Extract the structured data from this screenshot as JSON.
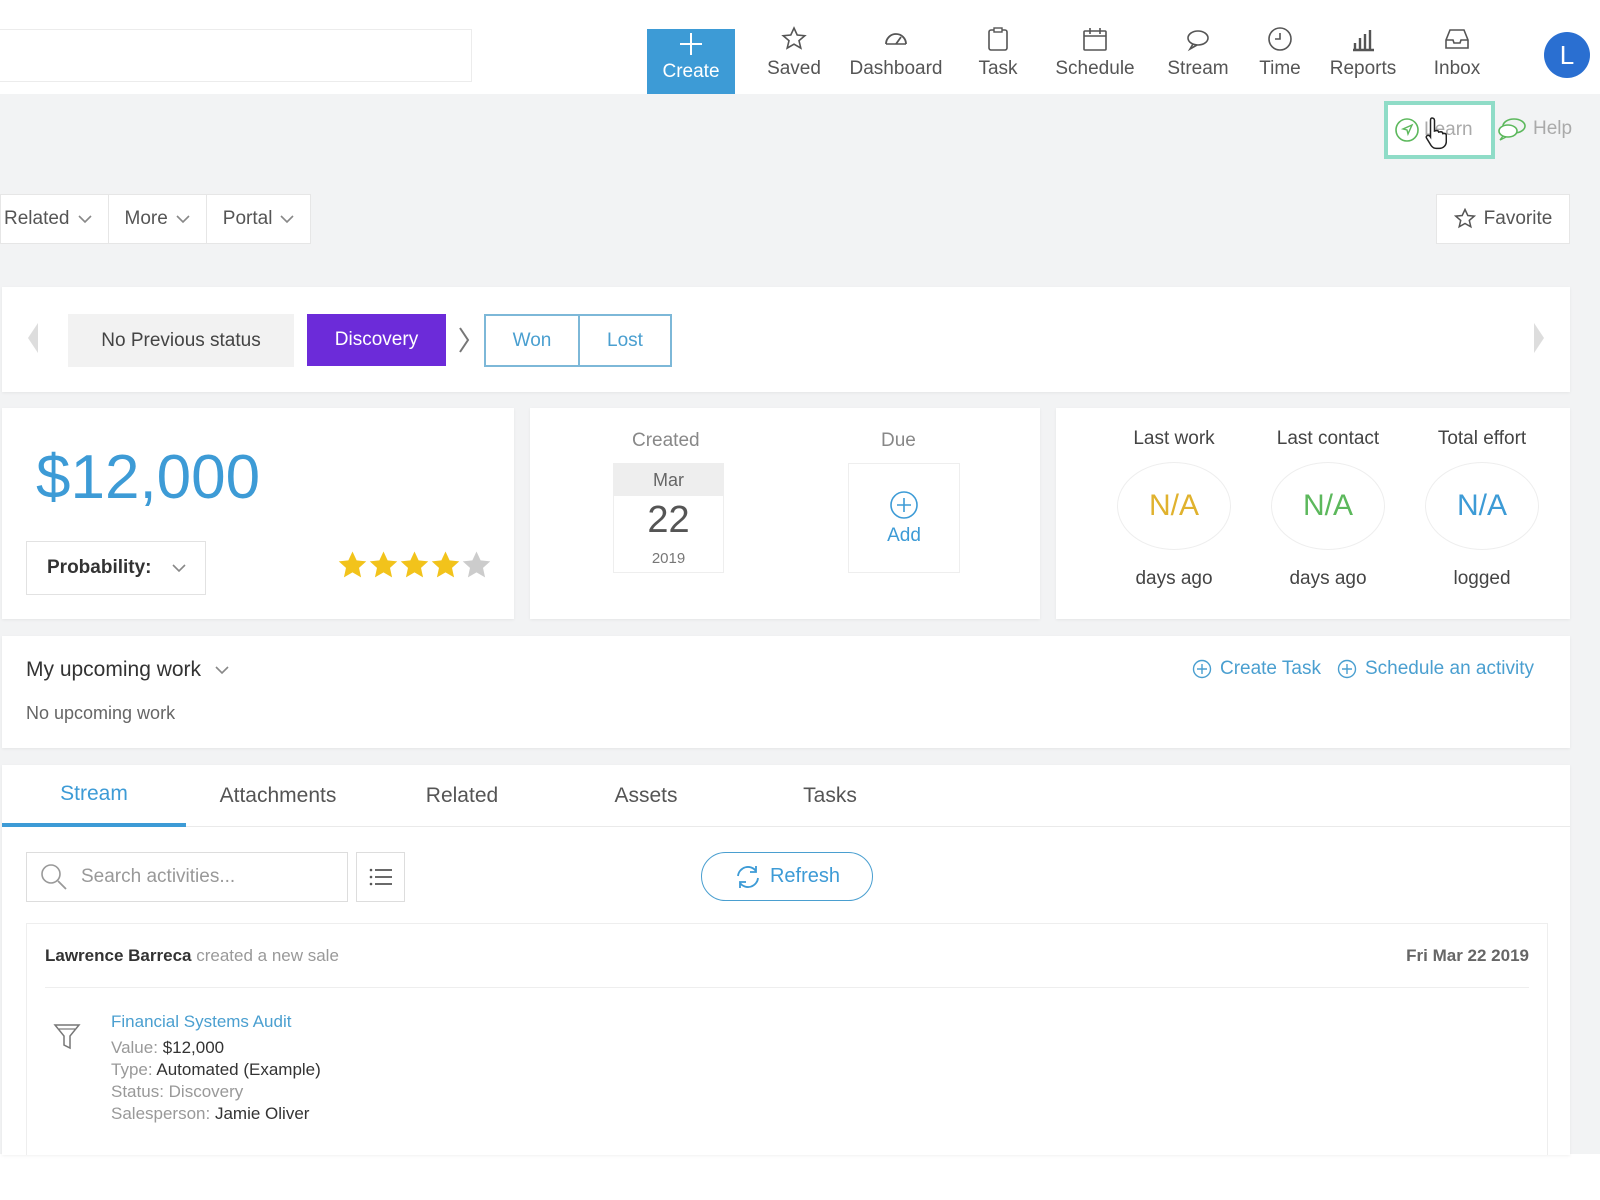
{
  "nav": {
    "items": [
      {
        "label": "Create",
        "icon": "plus-icon"
      },
      {
        "label": "Saved",
        "icon": "star-icon"
      },
      {
        "label": "Dashboard",
        "icon": "gauge-icon"
      },
      {
        "label": "Task",
        "icon": "clipboard-icon"
      },
      {
        "label": "Schedule",
        "icon": "calendar-icon"
      },
      {
        "label": "Stream",
        "icon": "chat-icon"
      },
      {
        "label": "Time",
        "icon": "clock-icon"
      },
      {
        "label": "Reports",
        "icon": "bar-chart-icon"
      },
      {
        "label": "Inbox",
        "icon": "inbox-icon"
      }
    ],
    "avatar_initial": "L"
  },
  "help": {
    "learn_label": "Learn",
    "help_label": "Help"
  },
  "menu": {
    "related_label": "Related",
    "more_label": "More",
    "portal_label": "Portal",
    "favorite_label": "Favorite"
  },
  "status": {
    "previous_label": "No Previous status",
    "current_label": "Discovery",
    "won_label": "Won",
    "lost_label": "Lost"
  },
  "deal": {
    "value": "$12,000",
    "probability_label": "Probability:",
    "rating": 4,
    "rating_max": 5
  },
  "dates": {
    "created_label": "Created",
    "created_month": "Mar",
    "created_day": "22",
    "created_year": "2019",
    "due_label": "Due",
    "add_label": "Add"
  },
  "metrics": [
    {
      "title": "Last work",
      "value": "N/A",
      "sub": "days ago",
      "color": "#e0b22e"
    },
    {
      "title": "Last contact",
      "value": "N/A",
      "sub": "days ago",
      "color": "#5cb85c"
    },
    {
      "title": "Total effort",
      "value": "N/A",
      "sub": "logged",
      "color": "#3d9bd6"
    }
  ],
  "upcoming": {
    "title": "My upcoming work",
    "empty_text": "No upcoming work",
    "create_task_label": "Create Task",
    "schedule_label": "Schedule an activity"
  },
  "tabs": {
    "items": [
      "Stream",
      "Attachments",
      "Related",
      "Assets",
      "Tasks"
    ],
    "active": "Stream"
  },
  "stream": {
    "search_placeholder": "Search activities...",
    "refresh_label": "Refresh",
    "activity": {
      "author": "Lawrence Barreca",
      "verb": "created a new sale",
      "date": "Fri Mar 22 2019",
      "title": "Financial Systems Audit",
      "value_key": "Value:",
      "value_val": "$12,000",
      "type_key": "Type:",
      "type_val": "Automated (Example)",
      "status_key": "Status:",
      "status_val": "Discovery",
      "salesperson_key": "Salesperson:",
      "salesperson_val": "Jamie Oliver"
    }
  },
  "colors": {
    "accent": "#3d9bd6",
    "status_current": "#6c2bd9",
    "learn_highlight": "#8fdcc7"
  }
}
